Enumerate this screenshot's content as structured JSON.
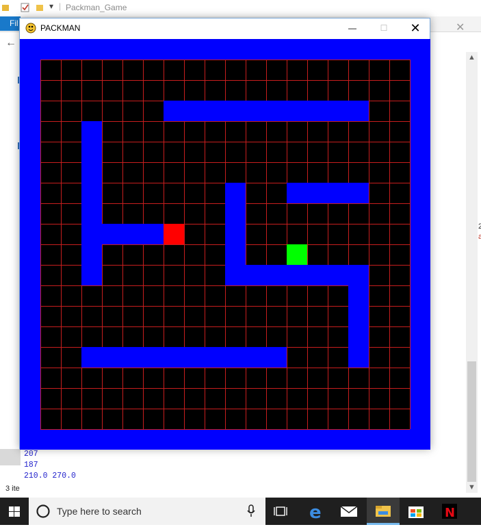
{
  "explorer": {
    "title": "Packman_Game",
    "file_tab": "Fil",
    "item_count": "3 ite",
    "right_fragment_1": "2",
    "right_fragment_2": "a"
  },
  "console": {
    "lines": [
      "207",
      "187",
      "210.0 270.0"
    ]
  },
  "game_window": {
    "title": "PACKMAN",
    "controls": {
      "minimize": "—",
      "maximize": "☐",
      "close": "✕"
    }
  },
  "game_board": {
    "grid_cols": 18,
    "grid_rows": 18,
    "colors": {
      "border": "#0000ff",
      "floor": "#000000",
      "grid_lines": "#c81e1e",
      "walls": "#0000ff",
      "player": "#ff0000",
      "target": "#00ff00"
    },
    "walls_cells": [
      [
        6,
        2,
        10,
        1
      ],
      [
        2,
        3,
        1,
        8
      ],
      [
        3,
        8,
        3,
        1
      ],
      [
        9,
        6,
        1,
        5
      ],
      [
        10,
        10,
        5,
        1
      ],
      [
        12,
        6,
        4,
        1
      ],
      [
        15,
        10,
        1,
        5
      ],
      [
        2,
        14,
        10,
        1
      ]
    ],
    "player_cell": [
      6,
      8
    ],
    "target_cell": [
      12,
      9
    ]
  },
  "taskbar": {
    "search_placeholder": "Type here to search",
    "icons": [
      "task-view-icon",
      "edge-icon",
      "mail-icon",
      "file-explorer-icon",
      "store-icon",
      "netflix-icon"
    ]
  }
}
